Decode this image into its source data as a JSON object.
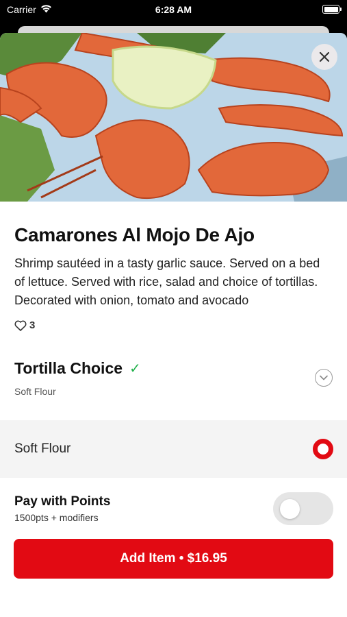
{
  "status_bar": {
    "carrier": "Carrier",
    "time": "6:28 AM"
  },
  "item": {
    "title": "Camarones Al Mojo De Ajo",
    "description": "Shrimp sautéed in a tasty garlic sauce. Served on a bed of lettuce. Served with rice, salad and choice of tortillas. Decorated with onion, tomato and avocado",
    "likes": "3"
  },
  "modifier_group": {
    "title": "Tortilla Choice",
    "selected_summary": "Soft Flour",
    "options": [
      {
        "label": "Soft Flour",
        "selected": true
      }
    ]
  },
  "points": {
    "title": "Pay with Points",
    "subtitle": "1500pts + modifiers",
    "enabled": false
  },
  "add_button": {
    "label": "Add Item • $16.95"
  },
  "colors": {
    "accent": "#e20a13",
    "check": "#22b14c",
    "toggle_off": "#e5e5e5"
  },
  "icons": {
    "close": "close-icon",
    "heart": "heart-icon",
    "check": "check-icon",
    "chevron": "chevron-down-icon",
    "wifi": "wifi-icon",
    "battery": "battery-icon"
  }
}
